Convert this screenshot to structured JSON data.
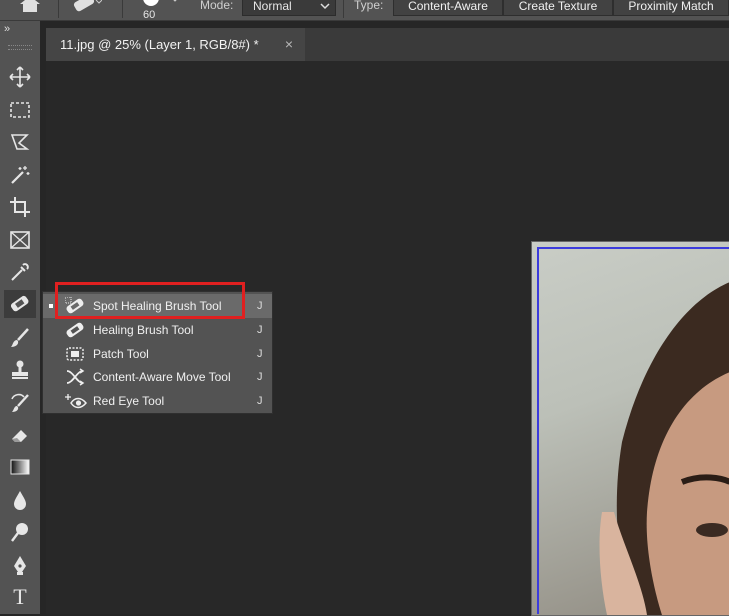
{
  "options_bar": {
    "brush_size": "60",
    "mode_label": "Mode:",
    "mode_value": "Normal",
    "type_label": "Type:",
    "type_buttons": [
      "Content-Aware",
      "Create Texture",
      "Proximity Match"
    ]
  },
  "document_tab": {
    "title": "11.jpg @ 25% (Layer 1, RGB/8#) *",
    "close": "×"
  },
  "toolbar": {
    "collapse": "»",
    "tools": [
      "move-tool",
      "rectangular-marquee-tool",
      "lasso-tool",
      "magic-wand-tool",
      "crop-tool",
      "frame-tool",
      "eyedropper-tool",
      "spot-healing-brush-tool",
      "brush-tool",
      "clone-stamp-tool",
      "history-brush-tool",
      "eraser-tool",
      "gradient-tool",
      "blur-tool",
      "dodge-tool",
      "pen-tool",
      "type-tool"
    ],
    "type_tool_glyph": "T"
  },
  "flyout": {
    "items": [
      {
        "label": "Spot Healing Brush Tool",
        "key": "J",
        "selected": true
      },
      {
        "label": "Healing Brush Tool",
        "key": "J",
        "selected": false
      },
      {
        "label": "Patch Tool",
        "key": "J",
        "selected": false
      },
      {
        "label": "Content-Aware Move Tool",
        "key": "J",
        "selected": false
      },
      {
        "label": "Red Eye Tool",
        "key": "J",
        "selected": false
      }
    ]
  },
  "colors": {
    "highlight": "#e02020",
    "guide": "#3c3cdc"
  }
}
